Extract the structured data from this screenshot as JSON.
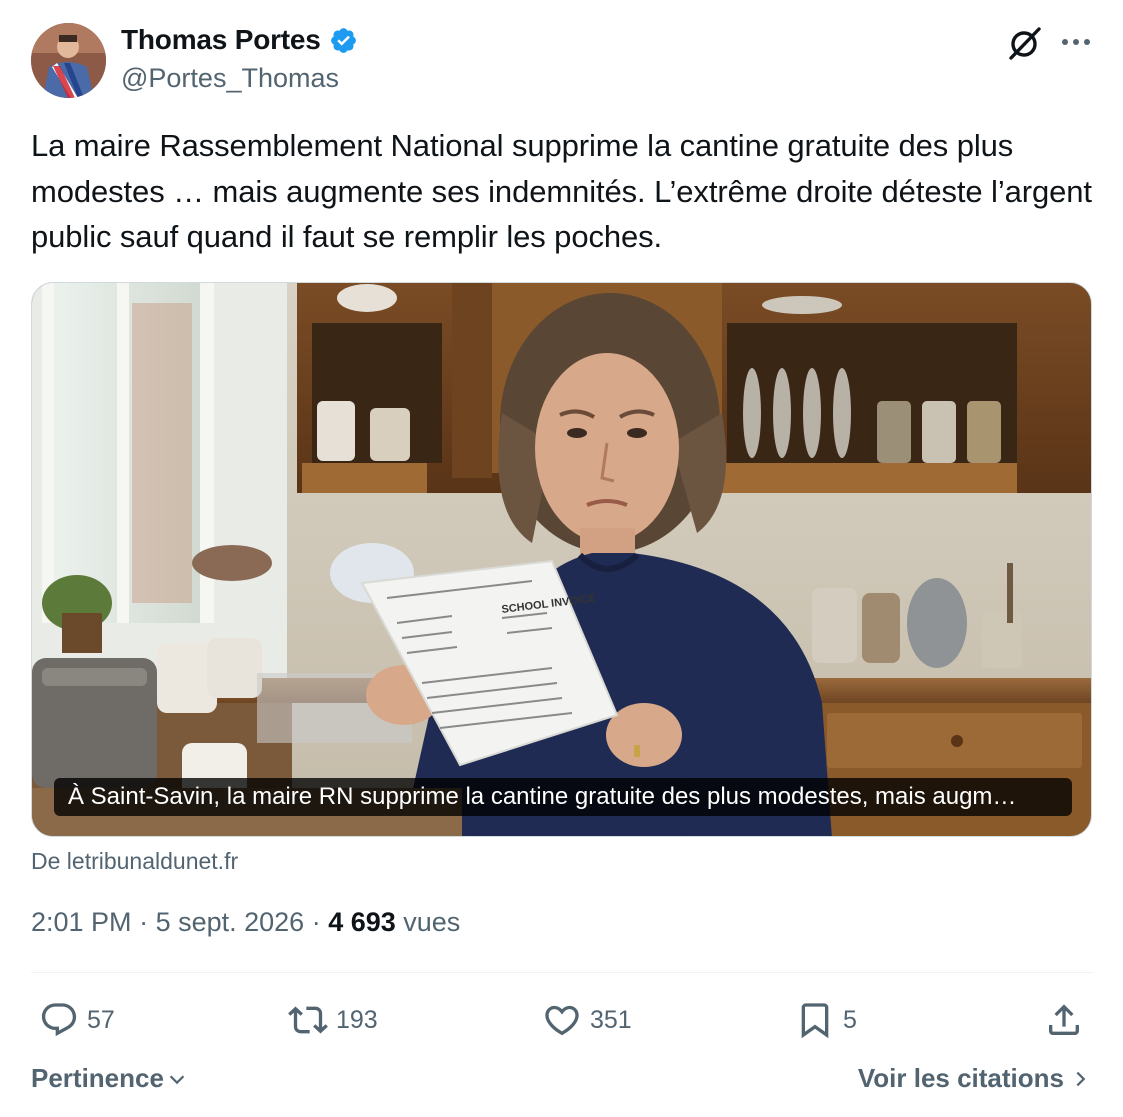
{
  "author": {
    "display_name": "Thomas Portes",
    "handle": "@Portes_Thomas",
    "verified": true,
    "avatar_icon": "avatar-photo"
  },
  "header_icons": [
    "grok-icon",
    "more-icon"
  ],
  "tweet": {
    "text": "La maire Rassemblement National supprime la cantine gratuite des plus modestes … mais augmente ses indemnités. L’extrême droite déteste l’argent public sauf quand il faut se remplir les poches."
  },
  "card": {
    "caption": "À Saint-Savin, la maire RN supprime la cantine gratuite des plus modestes, mais augm…",
    "source": "De letribunaldunet.fr",
    "image_subject": "woman reading a school invoice in a kitchen",
    "invoice_heading": "SCHOOL INVOICE"
  },
  "meta": {
    "time": "2:01 PM",
    "separator": " · ",
    "date": "5 sept. 2026",
    "views_count": "4 693",
    "views_label": " vues"
  },
  "actions": {
    "replies": "57",
    "retweets": "193",
    "likes": "351",
    "bookmarks": "5"
  },
  "footer": {
    "sort_label": "Pertinence",
    "quotes_label": "Voir les citations"
  },
  "colors": {
    "text": "#0f1419",
    "secondary": "#536471",
    "verified": "#1d9bf0"
  }
}
